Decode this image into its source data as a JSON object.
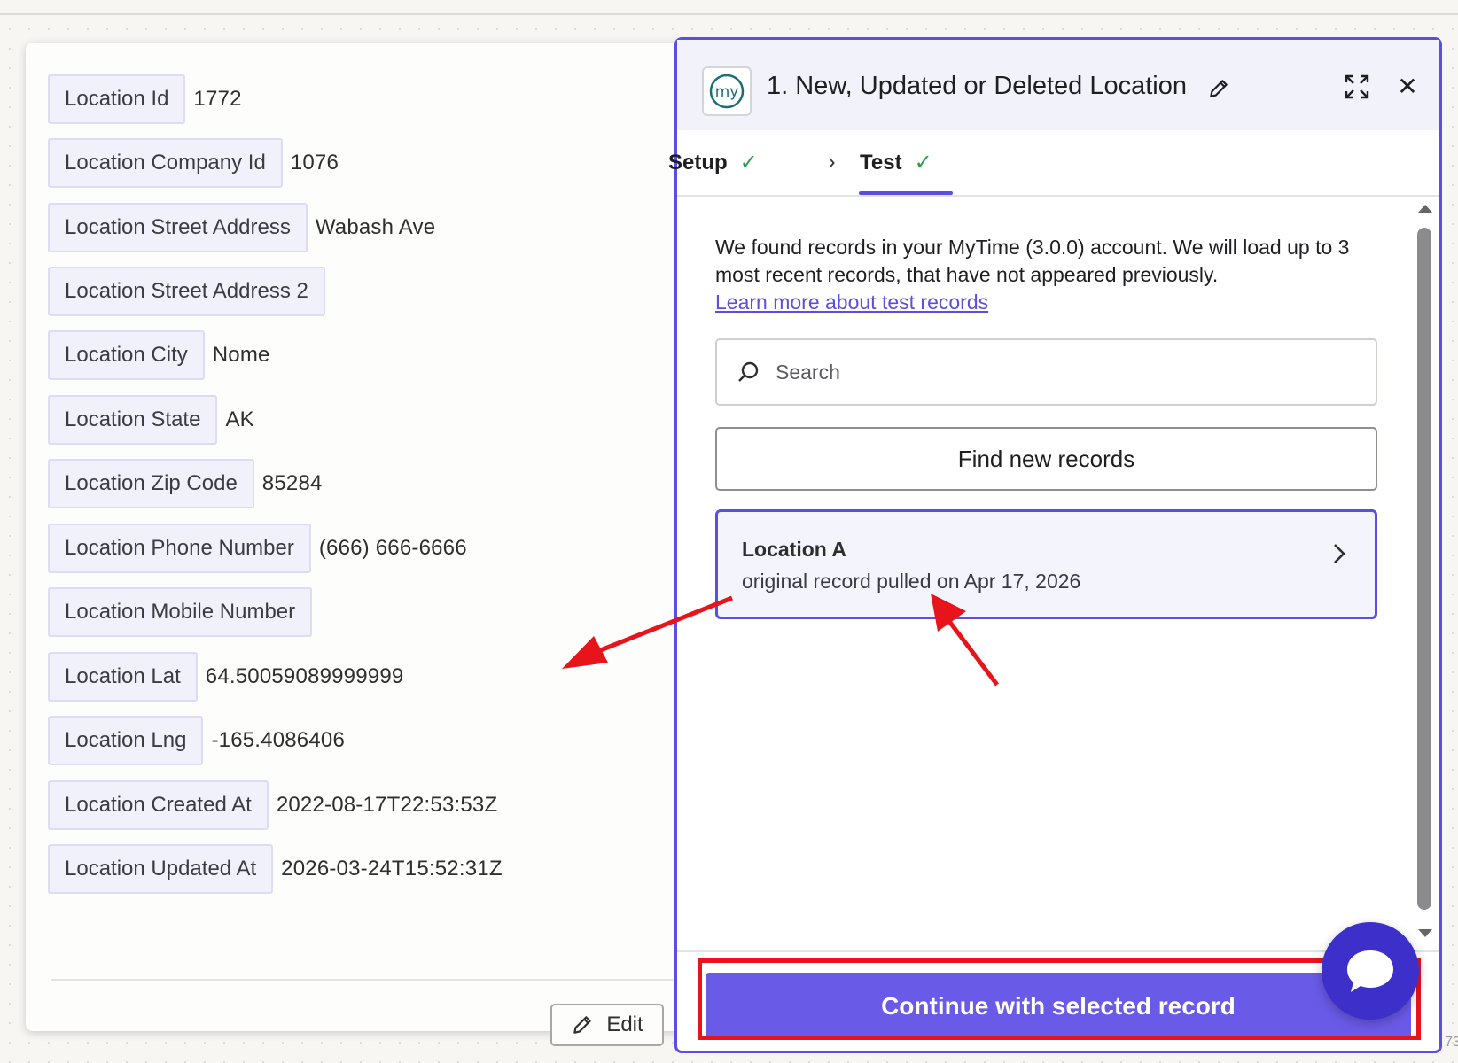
{
  "record_panel": {
    "fields": [
      {
        "key": "Location Id",
        "value": "1772"
      },
      {
        "key": "Location Company Id",
        "value": "1076"
      },
      {
        "key": "Location Street Address",
        "value": "Wabash Ave"
      },
      {
        "key": "Location Street Address 2",
        "value": ""
      },
      {
        "key": "Location City",
        "value": "Nome"
      },
      {
        "key": "Location State",
        "value": "AK"
      },
      {
        "key": "Location Zip Code",
        "value": "85284"
      },
      {
        "key": "Location Phone Number",
        "value": "(666) 666-6666"
      },
      {
        "key": "Location Mobile Number",
        "value": ""
      },
      {
        "key": "Location Lat",
        "value": "64.50059089999999"
      },
      {
        "key": "Location Lng",
        "value": "-165.4086406"
      },
      {
        "key": "Location Created At",
        "value": "2022-08-17T22:53:53Z"
      },
      {
        "key": "Location Updated At",
        "value": "2026-03-24T15:52:31Z"
      }
    ],
    "edit_label": "Edit"
  },
  "step_panel": {
    "title": "1. New, Updated or Deleted Location",
    "logo_text": "my",
    "tabs": [
      {
        "label": "Setup"
      },
      {
        "label": "Test"
      }
    ],
    "intro": "We found records in your MyTime (3.0.0) account. We will load up to 3 most recent records, that have not appeared previously.",
    "learn_link": "Learn more about test records",
    "search_placeholder": "Search",
    "find_button": "Find new records",
    "record": {
      "title": "Location A",
      "subtitle": "original record pulled on Apr 17, 2026"
    },
    "continue_button": "Continue with selected record"
  },
  "corner_text": "73",
  "colors": {
    "accent": "#5a4fe0",
    "button_bg": "#6a5ae8",
    "annotation_red": "#e8141c",
    "check_green": "#2e9a4e",
    "chat_bubble": "#3d2fc9"
  }
}
